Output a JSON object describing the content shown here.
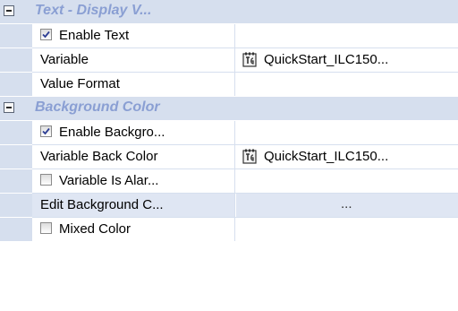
{
  "grid": {
    "categories": [
      {
        "title": "Text - Display V..."
      },
      {
        "title": "Background Color"
      }
    ],
    "text_props": {
      "enable_text": {
        "label": "Enable Text",
        "checked": true
      },
      "variable": {
        "label": "Variable",
        "value": "QuickStart_ILC150..."
      },
      "value_format": {
        "label": "Value Format",
        "value": ""
      }
    },
    "bg_props": {
      "enable_background": {
        "label": "Enable Backgro...",
        "checked": true
      },
      "variable_back_color": {
        "label": "Variable Back Color",
        "value": "QuickStart_ILC150..."
      },
      "variable_is_alarm": {
        "label": "Variable Is Alar...",
        "checked": false
      },
      "edit_background": {
        "label": "Edit Background C...",
        "value": "..."
      },
      "mixed_color": {
        "label": "Mixed Color",
        "checked": false
      }
    }
  },
  "colors": {
    "category_band": "#d6dfee",
    "category_title": "#8a9fd3",
    "selected_row": "#dfe6f3"
  }
}
